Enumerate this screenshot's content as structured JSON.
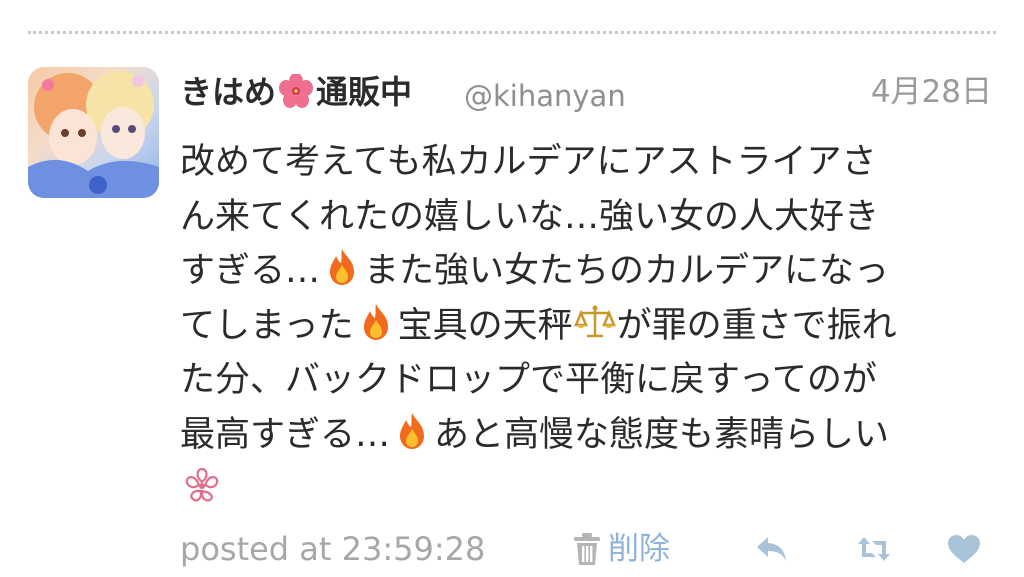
{
  "tweet": {
    "author": {
      "name_before_icon": "きはめ",
      "name_icon": "hibiscus-flower-icon",
      "name_after_icon": "通販中",
      "handle": "@kihanyan"
    },
    "date": "4月28日",
    "body_lines": [
      [
        "改めて考えても私カルデアにアストライアさ"
      ],
      [
        "ん来てくれたの嬉しいな…強い女の人大好き"
      ],
      [
        "すぎる…",
        "fire-icon",
        "また強い女たちのカルデアになっ"
      ],
      [
        "てしまった",
        "fire-icon",
        "宝具の天秤",
        "scales-icon",
        "が罪の重さで振れ"
      ],
      [
        "た分、バックドロップで平衡に戻すってのが"
      ],
      [
        "最高すぎる…",
        "fire-icon",
        "あと高慢な態度も素晴らしい"
      ],
      [
        "cherry-blossom-icon"
      ]
    ]
  },
  "footer": {
    "posted_at": "posted at 23:59:28",
    "delete_label": "削除",
    "actions": [
      "reply-icon",
      "retweet-icon",
      "like-heart-icon"
    ]
  },
  "colors": {
    "text": "#2b2b2b",
    "handle": "#8f8f8f",
    "meta": "#a7a7a7",
    "link": "#8fb4d9",
    "action_icon": "#a9c3d9"
  }
}
